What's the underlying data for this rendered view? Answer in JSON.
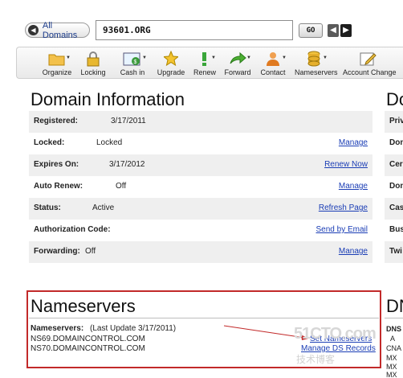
{
  "search": {
    "all_domains_label": "All Domains",
    "domain_value": "93601.ORG",
    "go_label": "GO"
  },
  "toolbar": [
    {
      "label": "Organize",
      "icon": "folder-icon"
    },
    {
      "label": "Locking",
      "icon": "lock-icon"
    },
    {
      "label": "Cash in",
      "icon": "cash-in-icon"
    },
    {
      "label": "Upgrade",
      "icon": "upgrade-star-icon"
    },
    {
      "label": "Renew",
      "icon": "renew-icon"
    },
    {
      "label": "Forward",
      "icon": "forward-arrow-icon"
    },
    {
      "label": "Contact",
      "icon": "contact-person-icon"
    },
    {
      "label": "Nameservers",
      "icon": "nameservers-stack-icon"
    },
    {
      "label": "Account Change",
      "icon": "account-change-pencil-icon"
    }
  ],
  "domain_info": {
    "title": "Domain Information",
    "rows": [
      {
        "key": "Registered:",
        "value": "3/17/2011",
        "action": ""
      },
      {
        "key": "Locked:",
        "value": "Locked",
        "action": "Manage"
      },
      {
        "key": "Expires On:",
        "value": "3/17/2012",
        "action": "Renew Now"
      },
      {
        "key": "Auto Renew:",
        "value": "Off",
        "action": "Manage"
      },
      {
        "key": "Status:",
        "value": "Active",
        "action": "Refresh Page"
      },
      {
        "key": "Authorization Code:",
        "value": "",
        "action": "Send by Email"
      },
      {
        "key": "Forwarding:",
        "value": "Off",
        "action": "Manage"
      }
    ]
  },
  "right_panel": {
    "title": "Do",
    "rows": [
      "Priv",
      "Don",
      "Cer",
      "Don",
      "Cas",
      "Bus",
      "Twi"
    ]
  },
  "nameservers": {
    "title": "Nameservers",
    "label": "Nameservers:",
    "last_update": "(Last Update 3/17/2011)",
    "servers": [
      "NS69.DOMAINCONTROL.COM",
      "NS70.DOMAINCONTROL.COM"
    ],
    "set_link": "Set Nameservers",
    "ds_link": "Manage DS Records"
  },
  "dns_panel": {
    "title": "DN",
    "header": "DNS",
    "rows": [
      "A",
      "CNA",
      "MX",
      "MX",
      "MX"
    ]
  },
  "watermark": {
    "line1": "51CTO.com",
    "line2": "技术博客"
  },
  "colors": {
    "highlight_border": "#c22a2a",
    "link": "#1a3db5",
    "arrow": "#c22a2a"
  }
}
